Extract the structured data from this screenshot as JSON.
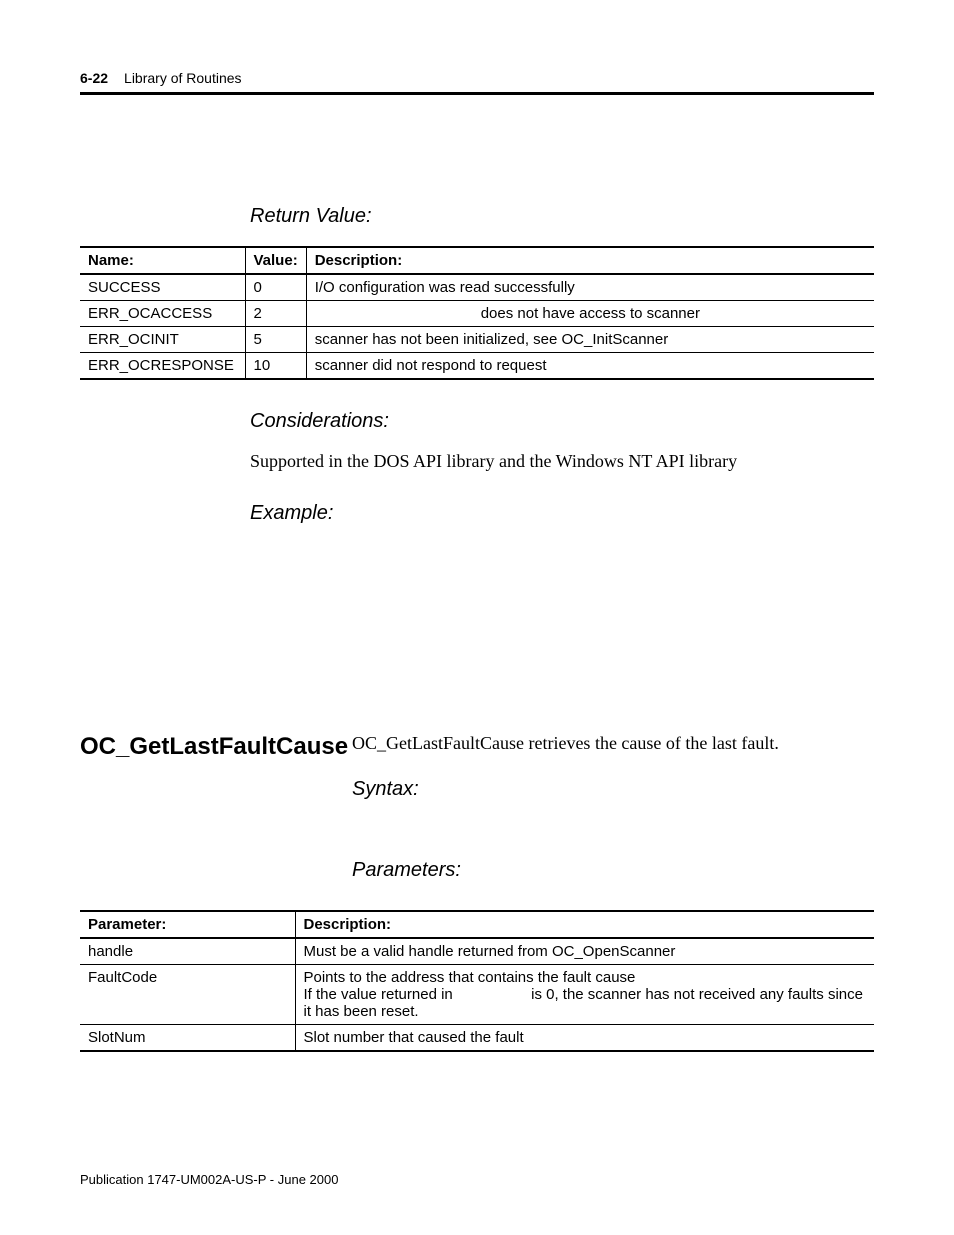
{
  "header": {
    "page_number": "6-22",
    "running_title": "Library of Routines"
  },
  "return_value": {
    "label": "Return Value:",
    "columns": {
      "name": "Name:",
      "value": "Value:",
      "description": "Description:"
    },
    "rows": [
      {
        "name": "SUCCESS",
        "value": "0",
        "description": "I/O configuration was read successfully"
      },
      {
        "name": "ERR_OCACCESS",
        "value": "2",
        "description": "does not have access to scanner",
        "centered": true
      },
      {
        "name": "ERR_OCINIT",
        "value": "5",
        "description": "scanner has not been initialized, see OC_InitScanner"
      },
      {
        "name": "ERR_OCRESPONSE",
        "value": "10",
        "description": "scanner did not respond to request"
      }
    ]
  },
  "considerations": {
    "label": "Considerations:",
    "text": "Supported in the DOS API library and the Windows NT API library"
  },
  "example": {
    "label": "Example:"
  },
  "section2": {
    "heading": "OC_GetLastFaultCause",
    "intro": "OC_GetLastFaultCause retrieves the cause of the last fault.",
    "syntax_label": "Syntax:",
    "parameters_label": "Parameters:",
    "param_columns": {
      "parameter": "Parameter:",
      "description": "Description:"
    },
    "param_rows": [
      {
        "param": "handle",
        "description": "Must be a valid handle returned from OC_OpenScanner"
      },
      {
        "param": "FaultCode",
        "description_line1_a": "Points to the address that contains the fault cause",
        "description_line2_a": "If the value returned in ",
        "description_line2_b": " is 0, the scanner has not received any faults since it has been reset."
      },
      {
        "param": "SlotNum",
        "description": "Slot number that caused the fault"
      }
    ]
  },
  "footer": {
    "text": "Publication 1747-UM002A-US-P - June 2000"
  }
}
